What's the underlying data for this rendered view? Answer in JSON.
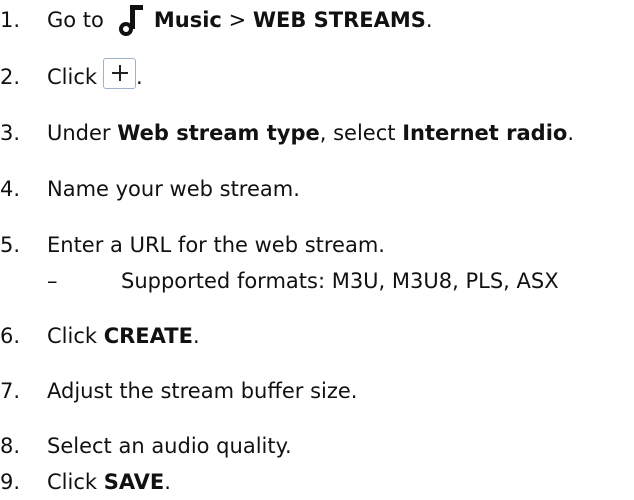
{
  "steps": [
    {
      "num": "1.",
      "pre": "Go to",
      "bold1": "Music",
      "mid": " > ",
      "bold2": "WEB STREAMS",
      "post": "."
    },
    {
      "num": "2.",
      "pre": "Click",
      "post": "."
    },
    {
      "num": "3.",
      "pre": "Under ",
      "bold1": "Web stream type",
      "mid": ", select ",
      "bold2": "Internet radio",
      "post": "."
    },
    {
      "num": "4.",
      "text": "Name your web stream."
    },
    {
      "num": "5.",
      "text": "Enter a URL for the web stream."
    },
    {
      "num": "6.",
      "pre": "Click ",
      "bold1": "CREATE",
      "post": "."
    },
    {
      "num": "7.",
      "text": "Adjust the stream buffer size."
    },
    {
      "num": "8.",
      "text": "Select an audio quality."
    },
    {
      "num": "9.",
      "pre": "Click ",
      "bold1": "SAVE",
      "post": "."
    }
  ],
  "sub_item": {
    "dash": "–",
    "text": "Supported formats: M3U, M3U8, PLS, ASX"
  },
  "icons": {
    "step1": "music-note-icon",
    "step2": "plus-icon"
  },
  "colors": {
    "text": "#111111",
    "plus_button_border": "#9fb3c8"
  }
}
